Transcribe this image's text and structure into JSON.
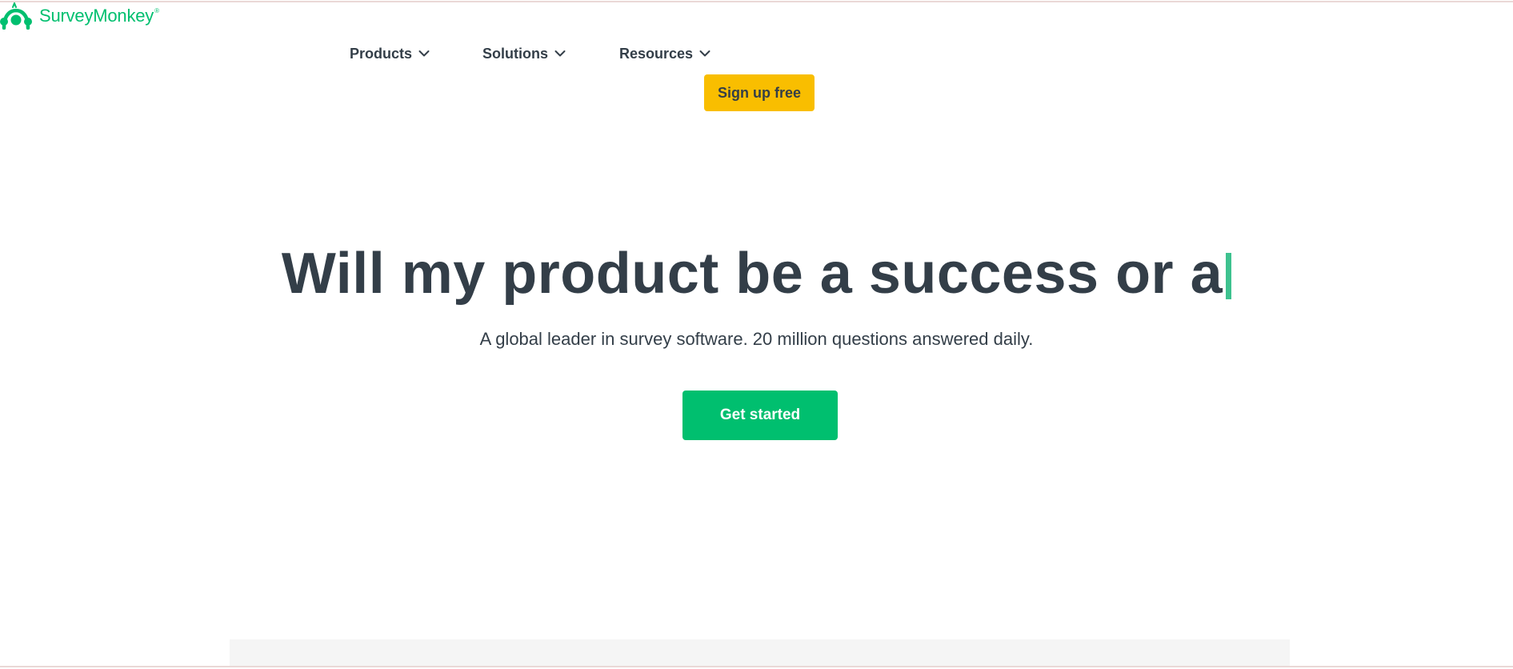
{
  "brand": {
    "name": "SurveyMonkey",
    "registered_mark": "®",
    "color": "#00bf6f"
  },
  "nav": {
    "items": [
      {
        "label": "Products",
        "icon": "chevron-down-icon"
      },
      {
        "label": "Solutions",
        "icon": "chevron-down-icon"
      },
      {
        "label": "Resources",
        "icon": "chevron-down-icon"
      }
    ],
    "signup_label": "Sign up free",
    "signup_color": "#f9be00"
  },
  "hero": {
    "title": "Will my product be a success or a",
    "caret_color": "#3ec28f",
    "subtitle": "A global leader in survey software. 20 million questions answered daily.",
    "cta_label": "Get started",
    "cta_color": "#00bf6f"
  }
}
